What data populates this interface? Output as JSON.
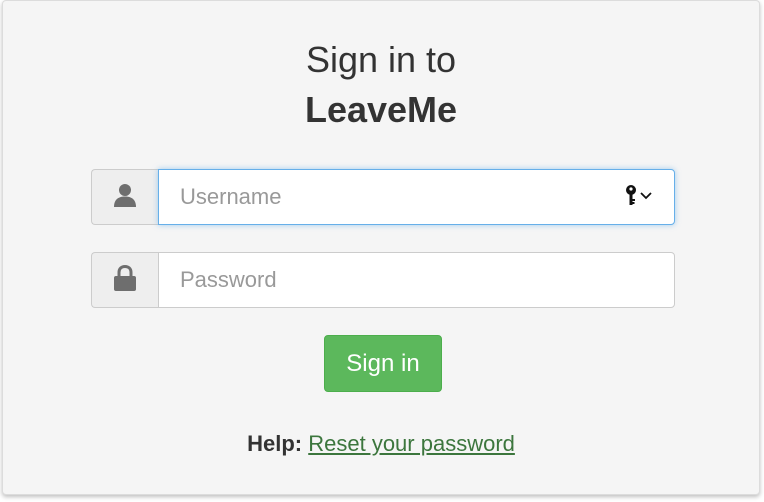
{
  "header": {
    "title_line1": "Sign in to",
    "title_line2": "LeaveMe"
  },
  "form": {
    "username": {
      "placeholder": "Username",
      "value": "",
      "icon": "user-icon"
    },
    "password": {
      "placeholder": "Password",
      "value": "",
      "icon": "lock-icon"
    },
    "submit_label": "Sign in"
  },
  "help": {
    "label": "Help:",
    "link_text": "Reset your password"
  },
  "colors": {
    "panel_bg": "#f5f5f5",
    "button_bg": "#5cb85c",
    "link": "#3c763d",
    "focus_border": "#66afe9"
  }
}
